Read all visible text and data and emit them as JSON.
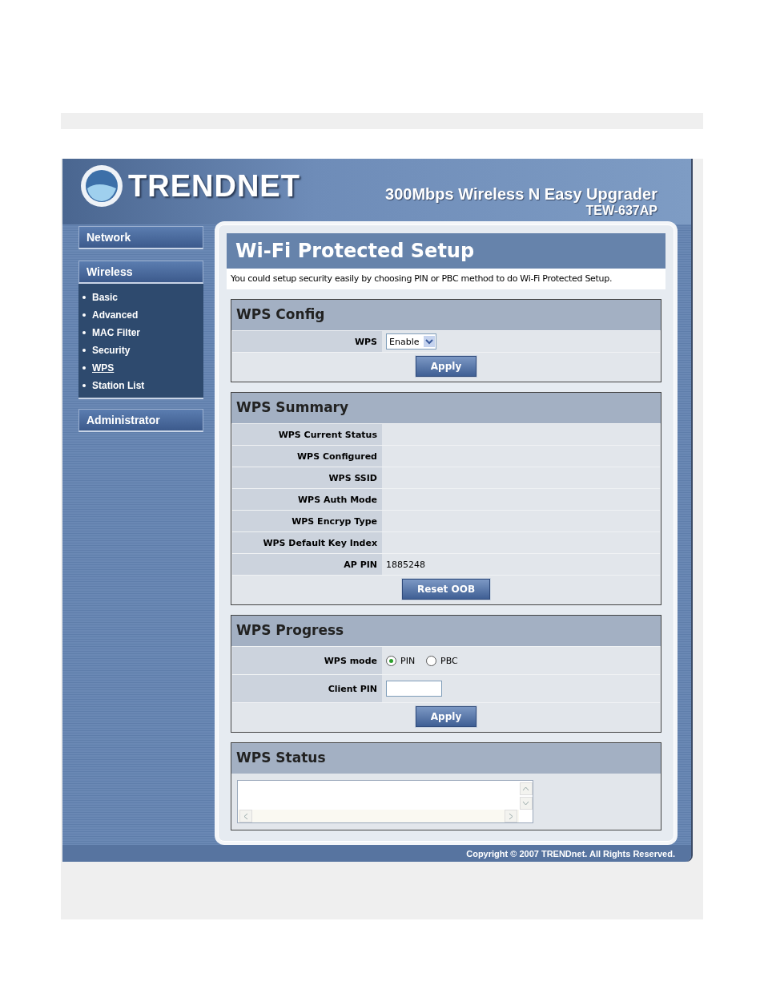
{
  "header": {
    "brand": "TRENDNET",
    "product": "300Mbps Wireless N Easy Upgrader",
    "model": "TEW-637AP"
  },
  "sidebar": [
    {
      "label": "Network"
    },
    {
      "label": "Wireless",
      "expanded": true,
      "children": [
        {
          "label": "Basic",
          "selected": false
        },
        {
          "label": "Advanced",
          "selected": false
        },
        {
          "label": "MAC Filter",
          "selected": false
        },
        {
          "label": "Security",
          "selected": false
        },
        {
          "label": "WPS",
          "selected": true
        },
        {
          "label": "Station List",
          "selected": false
        }
      ]
    },
    {
      "label": "Administrator"
    }
  ],
  "page": {
    "title": "Wi-Fi Protected Setup",
    "description": "You could setup security easily by choosing PIN or PBC method to do Wi-Fi Protected Setup."
  },
  "sections": [
    {
      "title": "WPS Config",
      "rows": [
        {
          "kind": "select",
          "label": "WPS",
          "value": "Enable"
        }
      ],
      "button": "Apply"
    },
    {
      "title": "WPS Summary",
      "rows": [
        {
          "kind": "text",
          "label": "WPS Current Status"
        },
        {
          "kind": "text",
          "label": "WPS Configured"
        },
        {
          "kind": "text",
          "label": "WPS SSID"
        },
        {
          "kind": "text",
          "label": "WPS Auth Mode"
        },
        {
          "kind": "text",
          "label": "WPS Encryp Type"
        },
        {
          "kind": "text",
          "label": "WPS Default Key Index"
        },
        {
          "kind": "text",
          "label": "AP PIN",
          "value": "1885248"
        }
      ],
      "button": "Reset OOB"
    },
    {
      "title": "WPS Progress",
      "rows": [
        {
          "kind": "radio",
          "label": "WPS mode",
          "options": [
            {
              "label": "PIN",
              "selected": true
            },
            {
              "label": "PBC",
              "selected": false
            }
          ]
        },
        {
          "kind": "input",
          "label": "Client PIN"
        }
      ],
      "button": "Apply"
    },
    {
      "title": "WPS Status",
      "rows": [
        {
          "kind": "log"
        }
      ]
    }
  ],
  "footer": {
    "copyright": "Copyright © 2007 TRENDnet. All Rights Reserved."
  }
}
